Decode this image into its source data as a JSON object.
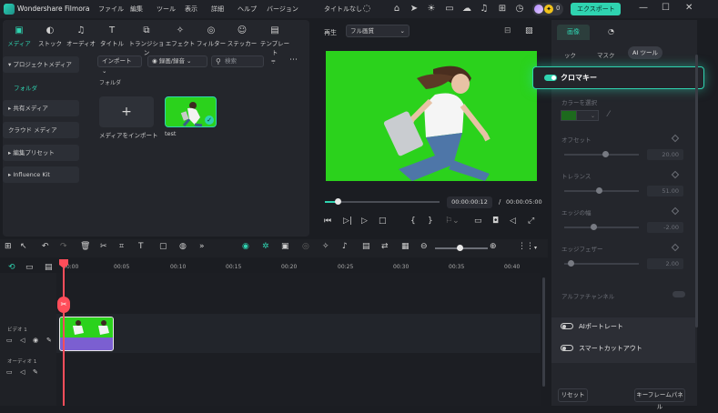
{
  "titlebar": {
    "app_name": "Wondershare Filmora",
    "menus": [
      "ファイル",
      "編集",
      "ツール",
      "表示",
      "詳細",
      "ヘルプ",
      "バージョン"
    ],
    "project_title": "タイトルなし",
    "credits": "0",
    "export_label": "エクスポート"
  },
  "media_tabs": [
    {
      "label": "メディア",
      "icon": "media-icon"
    },
    {
      "label": "ストック",
      "icon": "stock-icon"
    },
    {
      "label": "オーディオ",
      "icon": "music-icon"
    },
    {
      "label": "タイトル",
      "icon": "title-icon"
    },
    {
      "label": "トランジション",
      "icon": "transition-icon"
    },
    {
      "label": "エフェクト",
      "icon": "effect-icon"
    },
    {
      "label": "フィルター",
      "icon": "filter-icon"
    },
    {
      "label": "ステッカー",
      "icon": "sticker-icon"
    },
    {
      "label": "テンプレート",
      "icon": "template-icon"
    }
  ],
  "left_nav": {
    "project_media": "プロジェクトメディア",
    "folder": "フォルダ",
    "shared_media": "共有メディア",
    "cloud_media": "クラウド メディア",
    "adjust_presets": "編集プリセット",
    "influence_kit": "Influence Kit"
  },
  "media_toolbar": {
    "import_label": "インポート",
    "record_label": "録画/録音",
    "search_placeholder": "検索"
  },
  "media_grid": {
    "folder_label": "フォルダ",
    "import_tile_label": "メディアをインポート",
    "test_label": "test"
  },
  "preview": {
    "label": "再生",
    "quality": "フル画質",
    "current_time": "00:00:00:12",
    "separator": "/",
    "total_time": "00:00:05:00"
  },
  "props": {
    "tab_video": "画像",
    "subtab_partial": "ック",
    "subtab_mask": "マスク",
    "subtab_ai": "AI ツール",
    "chroma_label": "クロマキー",
    "color_select": "カラーを選択",
    "offset_label": "オフセット",
    "offset_value": "20.00",
    "tolerance_label": "トレランス",
    "tolerance_value": "51.00",
    "edge_thickness_label": "エッジの幅",
    "edge_thickness_value": "-2.00",
    "edge_feather_label": "エッジフェザー",
    "edge_feather_value": "2.00",
    "alpha_label": "アルファチャンネル",
    "ai_portrait": "AIポートレート",
    "smart_cutout": "スマートカットアウト",
    "reset": "リセット",
    "keyframe_panel": "キーフレームパネル",
    "accent": "#2fd3b0"
  },
  "timeline": {
    "ticks": [
      "00:00",
      "00:05",
      "00:10",
      "00:15",
      "00:20",
      "00:25",
      "00:30",
      "00:35",
      "00:40"
    ],
    "video_track": "ビデオ 1",
    "audio_track": "オーディオ 1"
  }
}
